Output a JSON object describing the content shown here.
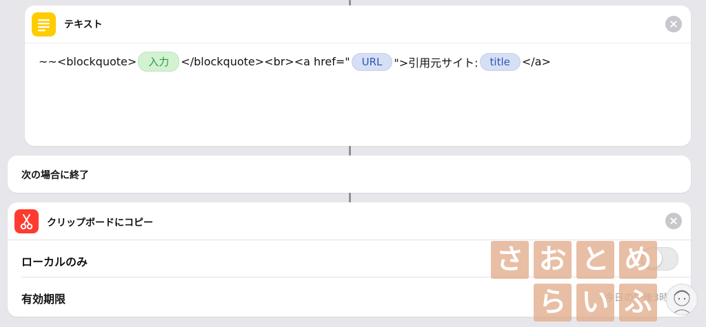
{
  "text_action": {
    "title": "テキスト",
    "icon": "text-lines-icon",
    "icon_color": "#ffcc00",
    "content": {
      "prefix": "~~<blockquote>",
      "var_input": "入力",
      "mid1": "</blockquote><br><a href=\"",
      "var_url": "URL",
      "mid2": "\">引用元サイト:",
      "var_title": "title",
      "suffix": "</a>"
    }
  },
  "end_if_action": {
    "title": "次の場合に終了"
  },
  "clipboard_action": {
    "title": "クリップボードにコピー",
    "icon": "scissors-icon",
    "icon_color": "#ff3b30",
    "local_only_label": "ローカルのみ",
    "local_only_value": false,
    "expiry_label": "有効期限",
    "expiry_value": "今日の午後3時"
  },
  "watermark": {
    "row1": [
      "さ",
      "お",
      "と",
      "め"
    ],
    "row2": [
      "ら",
      "い",
      "ふ"
    ],
    "color": "#e2ac8c"
  },
  "colors": {
    "background": "#e6e6eb",
    "green_pill": "#d3f2d1",
    "blue_pill": "#d6dff4"
  }
}
